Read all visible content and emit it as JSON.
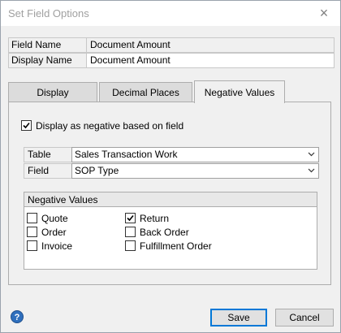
{
  "window": {
    "title": "Set Field Options",
    "close_glyph": "×"
  },
  "fields": [
    {
      "label": "Field Name",
      "value": "Document Amount"
    },
    {
      "label": "Display Name",
      "value": "Document Amount"
    }
  ],
  "tabs": [
    {
      "label": "Display",
      "active": false
    },
    {
      "label": "Decimal Places",
      "active": false
    },
    {
      "label": "Negative Values",
      "active": true
    }
  ],
  "panel": {
    "display_negative": {
      "label": "Display as negative based on field",
      "checked": true
    },
    "table": {
      "label": "Table",
      "value": "Sales Transaction Work"
    },
    "field": {
      "label": "Field",
      "value": "SOP Type"
    },
    "negative_values": {
      "header": "Negative Values",
      "items": [
        {
          "label": "Quote",
          "checked": false
        },
        {
          "label": "Order",
          "checked": false
        },
        {
          "label": "Invoice",
          "checked": false
        },
        {
          "label": "Return",
          "checked": true
        },
        {
          "label": "Back Order",
          "checked": false
        },
        {
          "label": "Fulfillment Order",
          "checked": false
        }
      ]
    }
  },
  "footer": {
    "help_glyph": "?",
    "save_label": "Save",
    "cancel_label": "Cancel"
  },
  "colors": {
    "accent": "#0078d7",
    "help": "#2f6fbd"
  }
}
